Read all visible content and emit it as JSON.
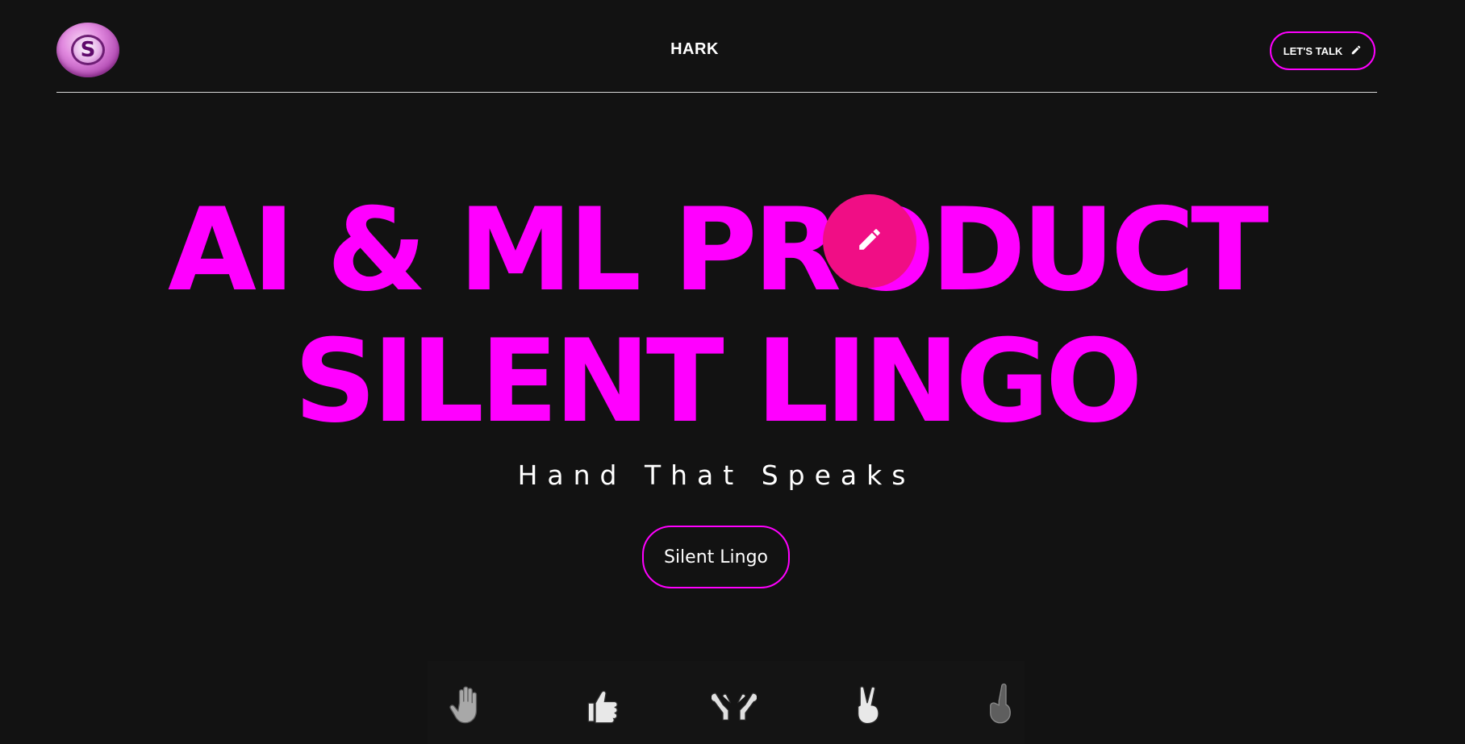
{
  "header": {
    "brand": "HARK",
    "cta_label": "LET'S TALK",
    "logo_letter": "S"
  },
  "hero": {
    "line1": "AI & ML PRODUCT",
    "line2": "SILENT LINGO",
    "tagline": "Hand That Speaks",
    "button_label": "Silent Lingo"
  },
  "gestures": [
    {
      "name": "raised-hand-icon"
    },
    {
      "name": "thumbs-up-icon"
    },
    {
      "name": "open-hands-icon"
    },
    {
      "name": "victory-hand-icon"
    },
    {
      "name": "pinky-hand-icon"
    }
  ],
  "colors": {
    "background": "#121212",
    "accent": "#ff00ff",
    "fab": "#f00e85",
    "text": "#ffffff"
  },
  "icons": {
    "talk_button": "pencil-icon",
    "fab": "pencil-icon"
  }
}
